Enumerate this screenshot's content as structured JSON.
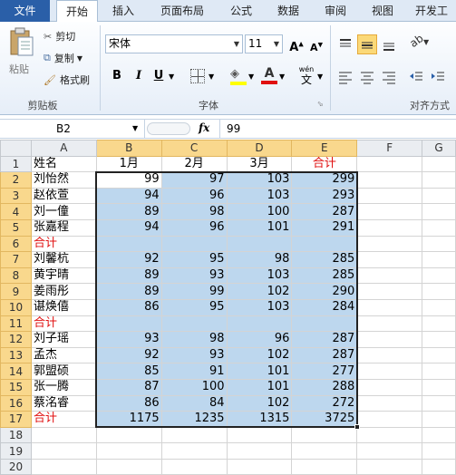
{
  "tabs": [
    "文件",
    "开始",
    "插入",
    "页面布局",
    "公式",
    "数据",
    "审阅",
    "视图",
    "开发工"
  ],
  "ribbon": {
    "clipboard": {
      "paste": "粘贴",
      "cut": "剪切",
      "copy": "复制",
      "format_painter": "格式刷",
      "label": "剪贴板"
    },
    "font": {
      "name": "宋体",
      "size": "11",
      "bold": "B",
      "italic": "I",
      "underline": "U",
      "label": "字体",
      "phonetic": "wén"
    },
    "align": {
      "label": "对齐方式"
    }
  },
  "namebox": {
    "value": "B2"
  },
  "formula": {
    "fx": "fx",
    "value": "99"
  },
  "columns": [
    "A",
    "B",
    "C",
    "D",
    "E",
    "F",
    "G"
  ],
  "rows": [
    {
      "n": "1",
      "a": "姓名",
      "b": "1月",
      "c": "2月",
      "d": "3月",
      "e": "合计",
      "header": true
    },
    {
      "n": "2",
      "a": "刘怡然",
      "b": "99",
      "c": "97",
      "d": "103",
      "e": "299"
    },
    {
      "n": "3",
      "a": "赵依萱",
      "b": "94",
      "c": "96",
      "d": "103",
      "e": "293"
    },
    {
      "n": "4",
      "a": "刘一僮",
      "b": "89",
      "c": "98",
      "d": "100",
      "e": "287"
    },
    {
      "n": "5",
      "a": "张嘉程",
      "b": "94",
      "c": "96",
      "d": "101",
      "e": "291"
    },
    {
      "n": "6",
      "a": "合计",
      "b": "",
      "c": "",
      "d": "",
      "e": "",
      "red": true
    },
    {
      "n": "7",
      "a": "刘馨杭",
      "b": "92",
      "c": "95",
      "d": "98",
      "e": "285"
    },
    {
      "n": "8",
      "a": "黄宇晴",
      "b": "89",
      "c": "93",
      "d": "103",
      "e": "285"
    },
    {
      "n": "9",
      "a": "姜雨彤",
      "b": "89",
      "c": "99",
      "d": "102",
      "e": "290"
    },
    {
      "n": "10",
      "a": "谌焕僖",
      "b": "86",
      "c": "95",
      "d": "103",
      "e": "284"
    },
    {
      "n": "11",
      "a": "合计",
      "b": "",
      "c": "",
      "d": "",
      "e": "",
      "red": true
    },
    {
      "n": "12",
      "a": "刘子瑶",
      "b": "93",
      "c": "98",
      "d": "96",
      "e": "287"
    },
    {
      "n": "13",
      "a": "孟杰",
      "b": "92",
      "c": "93",
      "d": "102",
      "e": "287"
    },
    {
      "n": "14",
      "a": "郭盟硕",
      "b": "85",
      "c": "91",
      "d": "101",
      "e": "277"
    },
    {
      "n": "15",
      "a": "张一腾",
      "b": "87",
      "c": "100",
      "d": "101",
      "e": "288"
    },
    {
      "n": "16",
      "a": "蔡洺睿",
      "b": "86",
      "c": "84",
      "d": "102",
      "e": "272"
    },
    {
      "n": "17",
      "a": "合计",
      "b": "1175",
      "c": "1235",
      "d": "1315",
      "e": "3725",
      "red": true
    },
    {
      "n": "18",
      "a": "",
      "b": "",
      "c": "",
      "d": "",
      "e": ""
    },
    {
      "n": "19",
      "a": "",
      "b": "",
      "c": "",
      "d": "",
      "e": ""
    },
    {
      "n": "20",
      "a": "",
      "b": "",
      "c": "",
      "d": "",
      "e": ""
    }
  ],
  "colors": {
    "accent": "#2a5fa8",
    "selection": "#bdd7ee",
    "header_selected": "#f9d88d",
    "red_text": "#e01010"
  }
}
